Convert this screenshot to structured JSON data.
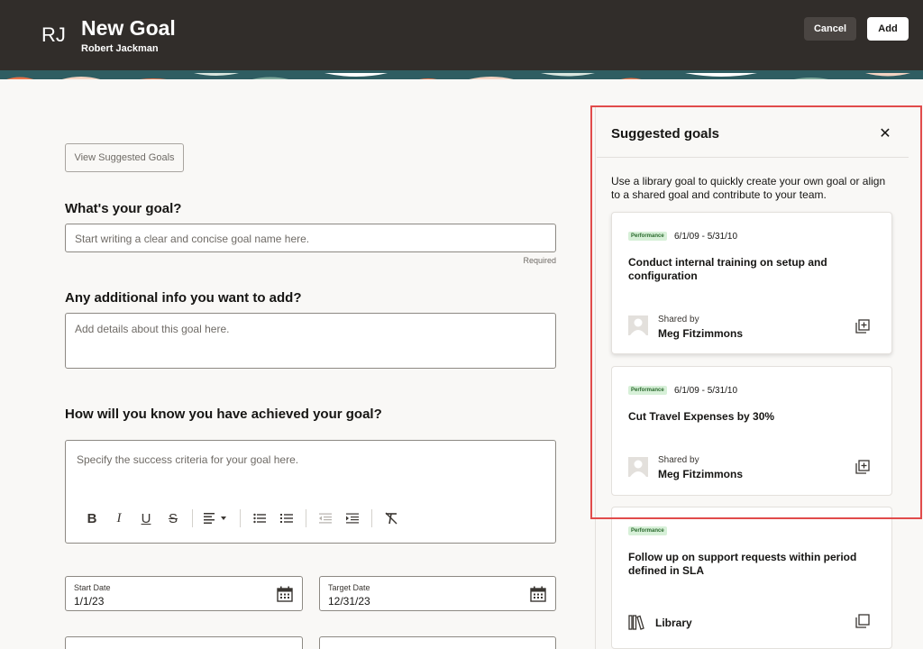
{
  "header": {
    "initials": "RJ",
    "title": "New Goal",
    "subtitle": "Robert Jackman",
    "cancel_label": "Cancel",
    "add_label": "Add",
    "background": "#312d2a"
  },
  "form": {
    "view_suggested_label": "View Suggested Goals",
    "goal_question": "What's your goal?",
    "goal_placeholder": "Start writing a clear and concise goal name here.",
    "required_label": "Required",
    "info_question": "Any additional info you want to add?",
    "info_placeholder": "Add details about this goal here.",
    "success_question": "How will you know you have achieved your goal?",
    "success_placeholder": "Specify the success criteria for your goal here.",
    "toolbar_icons": [
      "bold-icon",
      "italic-icon",
      "underline-icon",
      "strikethrough-icon",
      "align-icon",
      "bullet-list-icon",
      "numbered-list-icon",
      "outdent-icon",
      "indent-icon",
      "clear-format-icon"
    ],
    "start_date_label": "Start Date",
    "start_date_value": "1/1/23",
    "target_date_label": "Target Date",
    "target_date_value": "12/31/23"
  },
  "drawer": {
    "title": "Suggested goals",
    "close_icon": "close-icon",
    "description": "Use a library goal to quickly create your own goal or align to a shared goal and contribute to your team.",
    "outline_color": "#e14b4b",
    "cards": [
      {
        "badge": "Performance",
        "dates": "6/1/09 - 5/31/10",
        "title": "Conduct internal training on setup and configuration",
        "shared_by_label": "Shared by",
        "person": "Meg Fitzimmons",
        "action_icon": "add-copy-icon"
      },
      {
        "badge": "Performance",
        "dates": "6/1/09 - 5/31/10",
        "title": "Cut Travel Expenses by 30%",
        "shared_by_label": "Shared by",
        "person": "Meg Fitzimmons",
        "action_icon": "add-copy-icon"
      },
      {
        "badge": "Performance",
        "title": "Follow up on support requests within period defined in SLA",
        "source_label": "Library",
        "source_icon": "library-icon",
        "action_icon": "copy-icon"
      }
    ]
  }
}
